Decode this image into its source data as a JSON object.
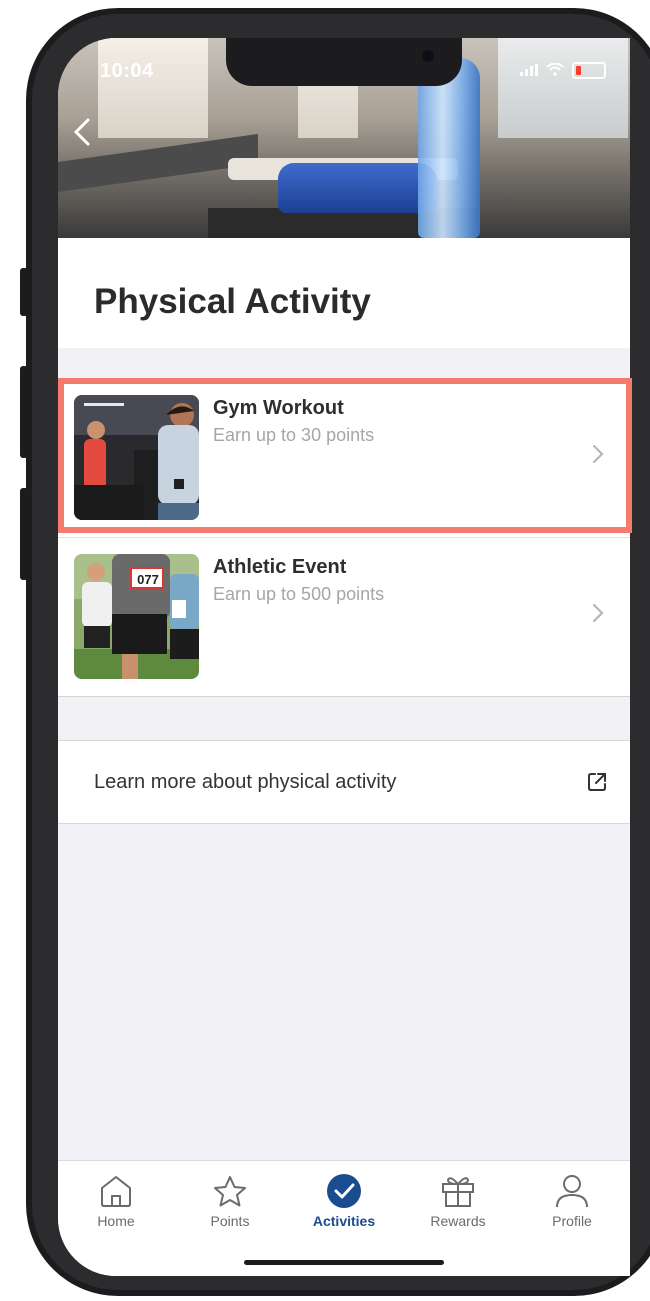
{
  "status_bar": {
    "time": "10:04"
  },
  "header": {
    "back_icon": "chevron-left-icon",
    "title": "Physical Activity"
  },
  "activities": [
    {
      "title": "Gym Workout",
      "subtitle": "Earn up to 30 points",
      "image": "gym-workout-photo"
    },
    {
      "title": "Athletic Event",
      "subtitle": "Earn up to 500 points",
      "image": "athletic-event-photo",
      "bib": "077"
    }
  ],
  "learn_more": {
    "label": "Learn more about physical activity",
    "icon": "external-link-icon"
  },
  "tab_bar": {
    "items": [
      {
        "label": "Home",
        "icon": "home-icon"
      },
      {
        "label": "Points",
        "icon": "star-icon"
      },
      {
        "label": "Activities",
        "icon": "check-circle-icon",
        "active": true
      },
      {
        "label": "Rewards",
        "icon": "gift-icon"
      },
      {
        "label": "Profile",
        "icon": "person-icon"
      }
    ]
  },
  "colors": {
    "accent": "#1a4c8f",
    "highlight_border": "#f47b6e"
  }
}
